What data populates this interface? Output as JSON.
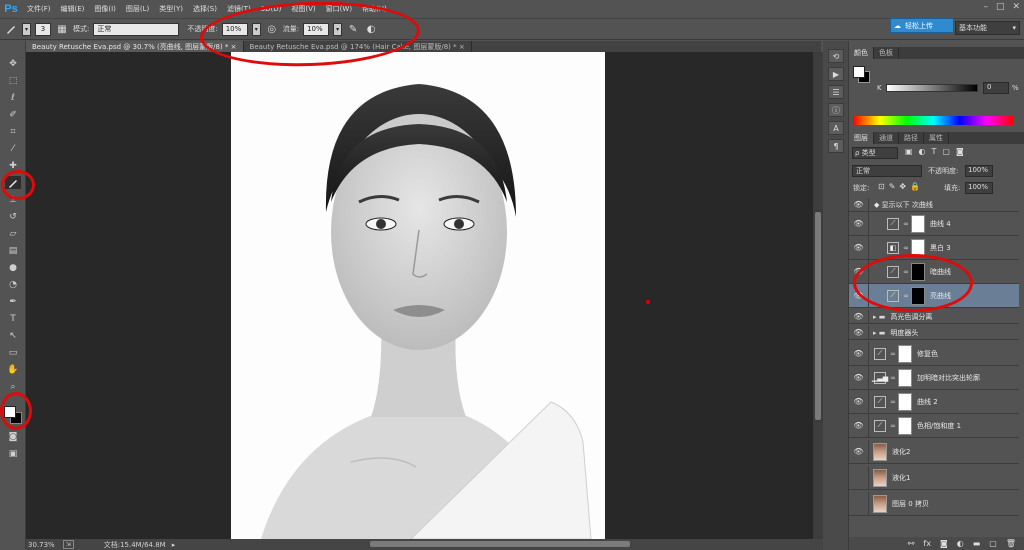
{
  "app": {
    "logo": "Ps"
  },
  "menu": [
    "文件(F)",
    "编辑(E)",
    "图像(I)",
    "图层(L)",
    "类型(Y)",
    "选择(S)",
    "滤镜(T)",
    "3D(D)",
    "视图(V)",
    "窗口(W)",
    "帮助(H)"
  ],
  "window_controls": [
    "–",
    "□",
    "✕"
  ],
  "options": {
    "brush_size": "3",
    "mode_label": "模式:",
    "mode_value": "正常",
    "opacity_label": "不透明度:",
    "opacity_value": "10%",
    "flow_label": "流量:",
    "flow_value": "10%"
  },
  "cloud_button": "轻松上传",
  "workspace": "基本功能",
  "doc_tabs": [
    "Beauty Retusche Eva.psd @ 30.7% (亮曲线, 图层蒙版/8) *  ×",
    "Beauty Retusche Eva.psd @ 174% (Hair Cake, 图层蒙版/8) *  ×"
  ],
  "status": {
    "zoom": "30.73%",
    "doc": "文档:15.4M/64.8M"
  },
  "color_panel": {
    "tabs": [
      "颜色",
      "色板"
    ],
    "channel": "K",
    "value": "0",
    "unit": "%"
  },
  "layers_panel": {
    "tabs": [
      "图层",
      "通道",
      "路径",
      "属性"
    ],
    "kind_label": "ρ 类型",
    "blend_mode": "正常",
    "opacity_label": "不透明度:",
    "opacity_value": "100%",
    "lock_label": "锁定:",
    "fill_label": "填充:",
    "fill_value": "100%",
    "layers": [
      {
        "name": "◆ 显示以下 次曲线",
        "type": "group"
      },
      {
        "name": "曲线 4",
        "type": "adjust",
        "mask": "white"
      },
      {
        "name": "黑白 3",
        "type": "adjust",
        "mask": "white"
      },
      {
        "name": "暗曲线",
        "type": "adjust",
        "mask": "black"
      },
      {
        "name": "亮曲线",
        "type": "adjust",
        "mask": "black",
        "selected": true
      },
      {
        "name": "高光色调分离",
        "type": "folder"
      },
      {
        "name": "明度器头",
        "type": "folder"
      },
      {
        "name": "修复色",
        "type": "adjust",
        "mask": "white"
      },
      {
        "name": "加明暗对比突出轮廓",
        "type": "adjust",
        "mask": "white"
      },
      {
        "name": "曲线 2",
        "type": "adjust",
        "mask": "white"
      },
      {
        "name": "色相/饱和度 1",
        "type": "adjust",
        "mask": "white"
      },
      {
        "name": "液化2",
        "type": "photo"
      },
      {
        "name": "液化1",
        "type": "photo"
      },
      {
        "name": "图层 0 拷贝",
        "type": "photo"
      }
    ],
    "footer_icons": [
      "link-icon",
      "fx-icon",
      "mask-icon",
      "adjustment-icon",
      "folder-icon",
      "new-layer-icon",
      "trash-icon"
    ]
  }
}
